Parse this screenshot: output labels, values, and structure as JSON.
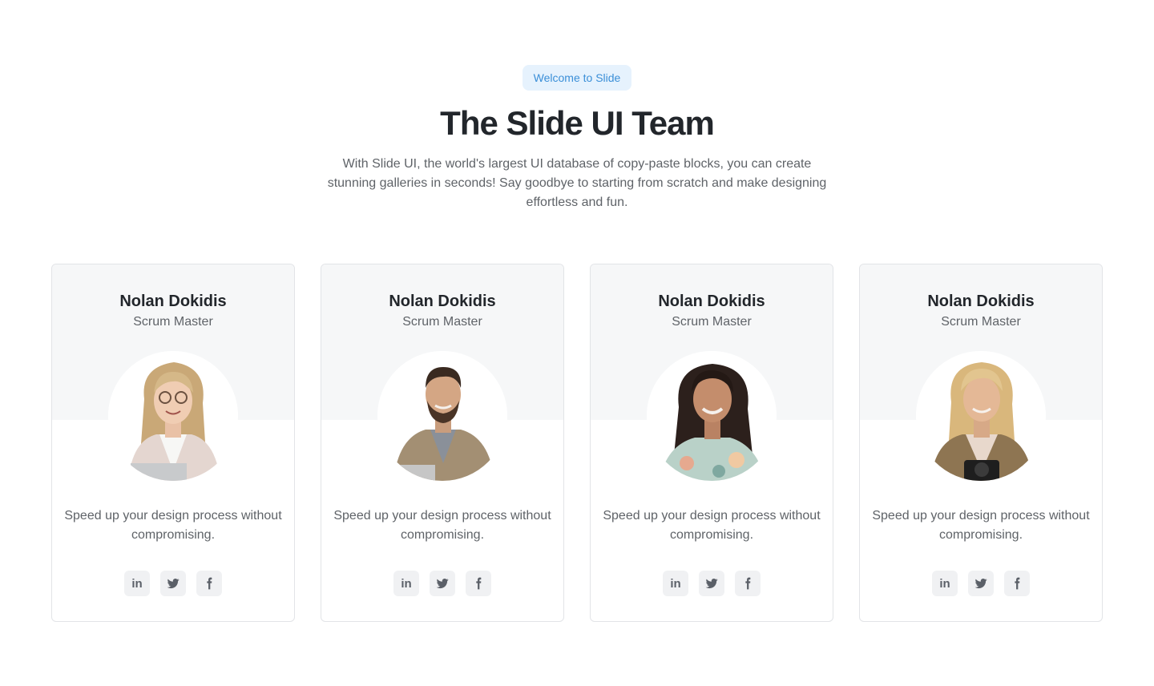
{
  "header": {
    "badge": "Welcome to Slide",
    "title": "The Slide UI Team",
    "subtitle": "With Slide UI, the world's largest UI database of copy-paste blocks, you can create stunning galleries in seconds! Say goodbye to starting from scratch and make designing effortless and fun."
  },
  "members": [
    {
      "name": "Nolan Dokidis",
      "role": "Scrum Master",
      "quote": "Speed up your design process without compromising.",
      "linkedin": "in"
    },
    {
      "name": "Nolan Dokidis",
      "role": "Scrum Master",
      "quote": "Speed up your design process without compromising.",
      "linkedin": "in"
    },
    {
      "name": "Nolan Dokidis",
      "role": "Scrum Master",
      "quote": "Speed up your design process without compromising.",
      "linkedin": "in"
    },
    {
      "name": "Nolan Dokidis",
      "role": "Scrum Master",
      "quote": "Speed up your design process without compromising.",
      "linkedin": "in"
    }
  ],
  "icons": {
    "linkedin": "linkedin-icon",
    "twitter": "twitter-icon",
    "facebook": "facebook-icon"
  },
  "colors": {
    "badge_bg": "#e6f2fd",
    "badge_text": "#3b8fd8",
    "card_top_bg": "#f6f7f8",
    "social_bg": "#f0f1f3"
  }
}
